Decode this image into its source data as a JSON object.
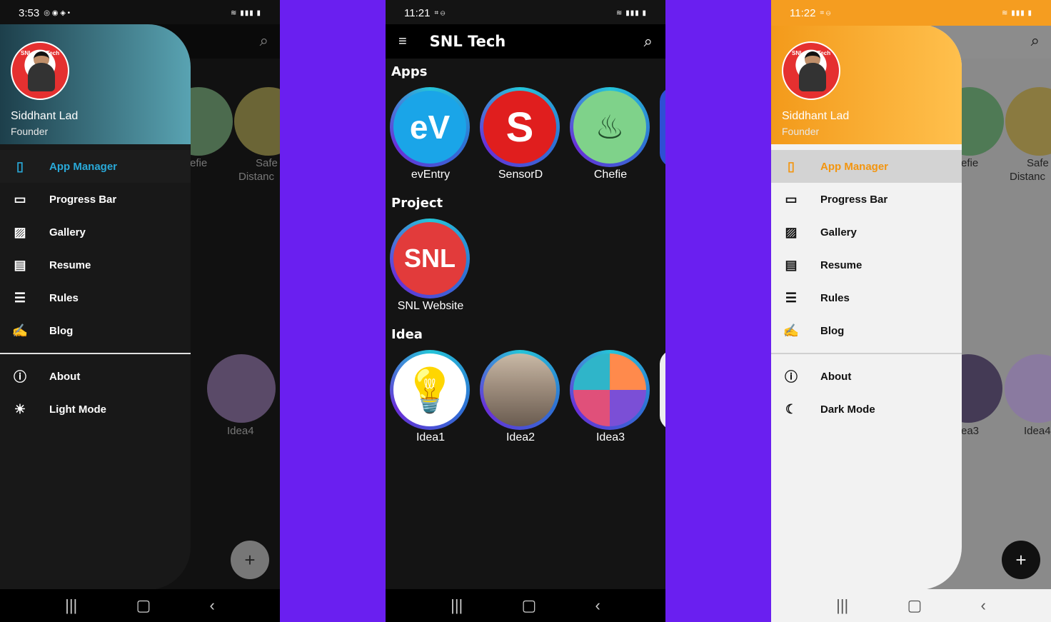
{
  "panel_left": {
    "status": {
      "time": "3:53"
    },
    "user": {
      "name": "Siddhant Lad",
      "role": "Founder"
    },
    "menu": [
      {
        "label": "App Manager",
        "icon": "phone-code-icon",
        "active": true
      },
      {
        "label": "Progress Bar",
        "icon": "progress-bar-icon"
      },
      {
        "label": "Gallery",
        "icon": "image-icon"
      },
      {
        "label": "Resume",
        "icon": "cv-icon"
      },
      {
        "label": "Rules",
        "icon": "clipboard-list-icon"
      },
      {
        "label": "Blog",
        "icon": "handwriting-icon"
      }
    ],
    "menu2": [
      {
        "label": "About",
        "icon": "info-icon"
      },
      {
        "label": "Light Mode",
        "icon": "sun-icon"
      }
    ],
    "behind": {
      "lbl1": "efie",
      "lbl2": "Safe",
      "lbl3": "Distanc",
      "lbl4": "Idea4"
    },
    "accent": "#29a9d8"
  },
  "panel_center": {
    "status": {
      "time": "11:21"
    },
    "app_title": "SNL Tech",
    "sections": {
      "apps": "Apps",
      "project": "Project",
      "idea": "Idea"
    },
    "apps": [
      "evEntry",
      "SensorD",
      "Chefie"
    ],
    "project": [
      "SNL Website"
    ],
    "ideas": [
      "Idea1",
      "Idea2",
      "Idea3"
    ]
  },
  "panel_right": {
    "status": {
      "time": "11:22"
    },
    "user": {
      "name": "Siddhant Lad",
      "role": "Founder"
    },
    "menu": [
      {
        "label": "App Manager",
        "icon": "phone-code-icon",
        "active": true
      },
      {
        "label": "Progress Bar",
        "icon": "progress-bar-icon"
      },
      {
        "label": "Gallery",
        "icon": "image-icon"
      },
      {
        "label": "Resume",
        "icon": "cv-icon"
      },
      {
        "label": "Rules",
        "icon": "clipboard-list-icon"
      },
      {
        "label": "Blog",
        "icon": "handwriting-icon"
      }
    ],
    "menu2": [
      {
        "label": "About",
        "icon": "info-icon"
      },
      {
        "label": "Dark Mode",
        "icon": "moon-icon"
      }
    ],
    "behind": {
      "lbl1": "efie",
      "lbl2": "Safe",
      "lbl3": "Distanc",
      "lbl4": "ea3",
      "lbl5": "Idea4"
    },
    "accent": "#f3950f"
  }
}
